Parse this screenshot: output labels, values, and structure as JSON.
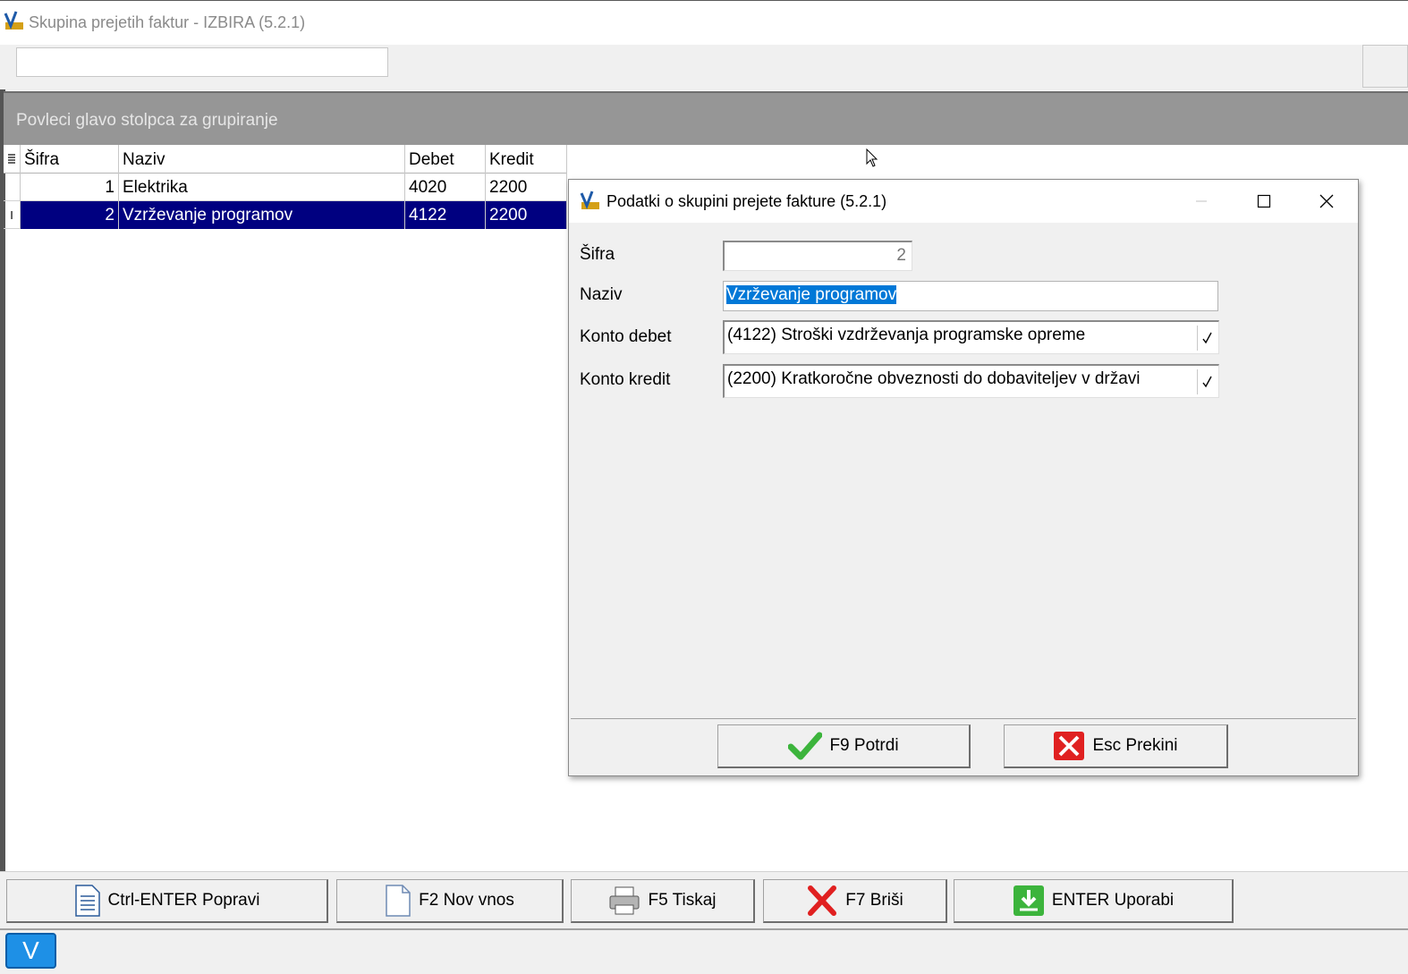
{
  "window": {
    "title": "Skupina prejetih faktur - IZBIRA  (5.2.1)"
  },
  "search": {
    "value": "",
    "placeholder": ""
  },
  "group_bar": {
    "text": "Povleci glavo stolpca za grupiranje"
  },
  "grid": {
    "columns": {
      "sifra": "Šifra",
      "naziv": "Naziv",
      "debet": "Debet",
      "kredit": "Kredit"
    },
    "rows": [
      {
        "sifra": "1",
        "naziv": "Elektrika",
        "debet": "4020",
        "kredit": "2200",
        "selected": false
      },
      {
        "sifra": "2",
        "naziv": "Vzrževanje programov",
        "debet": "4122",
        "kredit": "2200",
        "selected": true
      }
    ],
    "cursor_indicator": "I"
  },
  "dialog": {
    "title": "Podatki o skupini prejete fakture  (5.2.1)",
    "labels": {
      "sifra": "Šifra",
      "naziv": "Naziv",
      "konto_debet": "Konto debet",
      "konto_kredit": "Konto kredit"
    },
    "values": {
      "sifra": "2",
      "naziv": "Vzrževanje programov",
      "konto_debet": "(4122) Stroški vzdrževanja programske opreme",
      "konto_kredit": "(2200) Kratkoročne obveznosti do dobaviteljev v državi"
    },
    "buttons": {
      "potrdi": "F9 Potrdi",
      "prekini": "Esc Prekini"
    }
  },
  "toolbar": {
    "popravi": "Ctrl-ENTER Popravi",
    "nov_vnos": "F2 Nov vnos",
    "tiskaj": "F5 Tiskaj",
    "brisi": "F7 Briši",
    "uporabi": "ENTER Uporabi"
  },
  "statusbar": {
    "v_button": "V"
  },
  "colors": {
    "selection": "#000080",
    "group_bar": "#969696",
    "accent_blue": "#0078d7",
    "confirm_green": "#3cb43c",
    "cancel_red": "#e02020"
  },
  "icons": [
    "app-logo-icon",
    "minimize-icon",
    "maximize-icon",
    "close-icon",
    "checkmark-icon",
    "cancel-x-icon",
    "document-icon",
    "new-document-icon",
    "printer-icon",
    "delete-x-icon",
    "download-icon",
    "combo-check-icon",
    "mouse-pointer-icon"
  ]
}
